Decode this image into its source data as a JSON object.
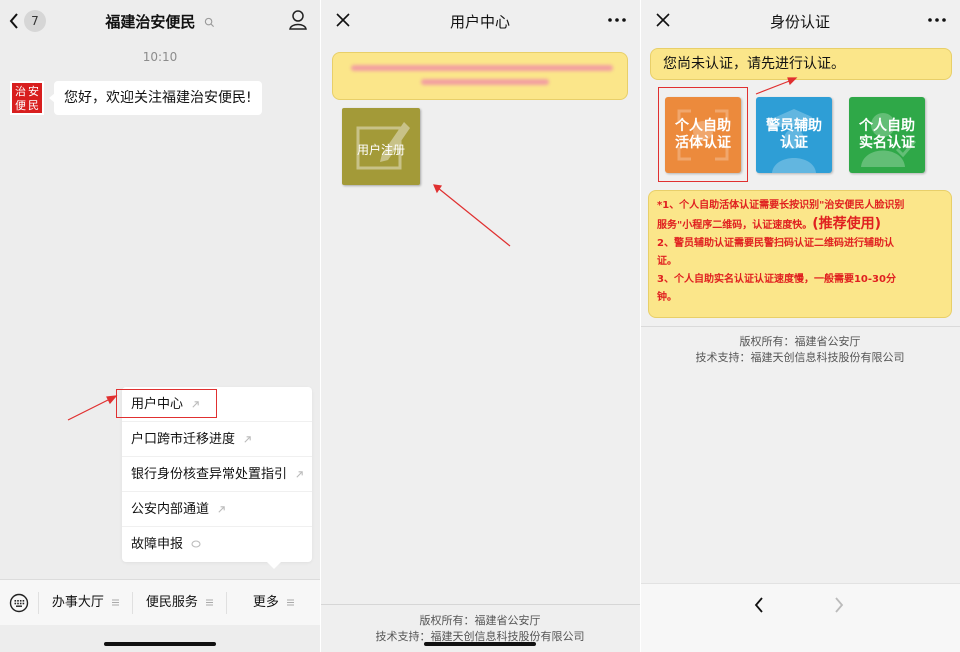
{
  "colors": {
    "accent_red": "#e03030",
    "notice_yellow": "#fbe68a",
    "tile_orange": "#ec8a3c",
    "tile_blue": "#2e9ed6",
    "tile_green": "#2fa848",
    "tile_olive": "#a39a38"
  },
  "chat": {
    "unread_count": "7",
    "title": "福建治安便民",
    "time": "10:10",
    "avatar_chars": [
      "治",
      "安",
      "便",
      "民"
    ],
    "message": "您好，欢迎关注福建治安便民!",
    "menu": [
      {
        "label": "用户中心",
        "icon": "link-icon"
      },
      {
        "label": "户口跨市迁移进度",
        "icon": "link-icon"
      },
      {
        "label": "银行身份核查异常处置指引",
        "icon": "link-icon"
      },
      {
        "label": "公安内部通道",
        "icon": "link-icon"
      },
      {
        "label": "故障申报",
        "icon": "chat-icon"
      }
    ],
    "tabs": [
      "办事大厅",
      "便民服务",
      "更多"
    ]
  },
  "user_center": {
    "title": "用户中心",
    "register_label": "用户注册",
    "footer_copyright": "版权所有：福建省公安厅",
    "footer_support": "技术支持：福建天创信息科技股份有限公司"
  },
  "identity": {
    "title": "身份认证",
    "notice": "您尚未认证，请先进行认证。",
    "tiles": [
      {
        "label_1": "个人自助",
        "label_2": "活体认证"
      },
      {
        "label_1": "警员辅助",
        "label_2": "认证"
      },
      {
        "label_1": "个人自助",
        "label_2": "实名认证"
      }
    ],
    "notes": {
      "line1": "*1、个人自助活体认证需要长按识别\"治安便民人脸识别",
      "line2": "服务\"小程序二维码，认证速度快。",
      "recommend": "(推荐使用)",
      "line3": "2、警员辅助认证需要民警扫码认证二维码进行辅助认",
      "line4": "证。",
      "line5": "3、个人自助实名认证认证速度慢，一般需要10-30分",
      "line6": "钟。"
    },
    "footer_copyright": "版权所有：福建省公安厅",
    "footer_support": "技术支持：福建天创信息科技股份有限公司"
  }
}
